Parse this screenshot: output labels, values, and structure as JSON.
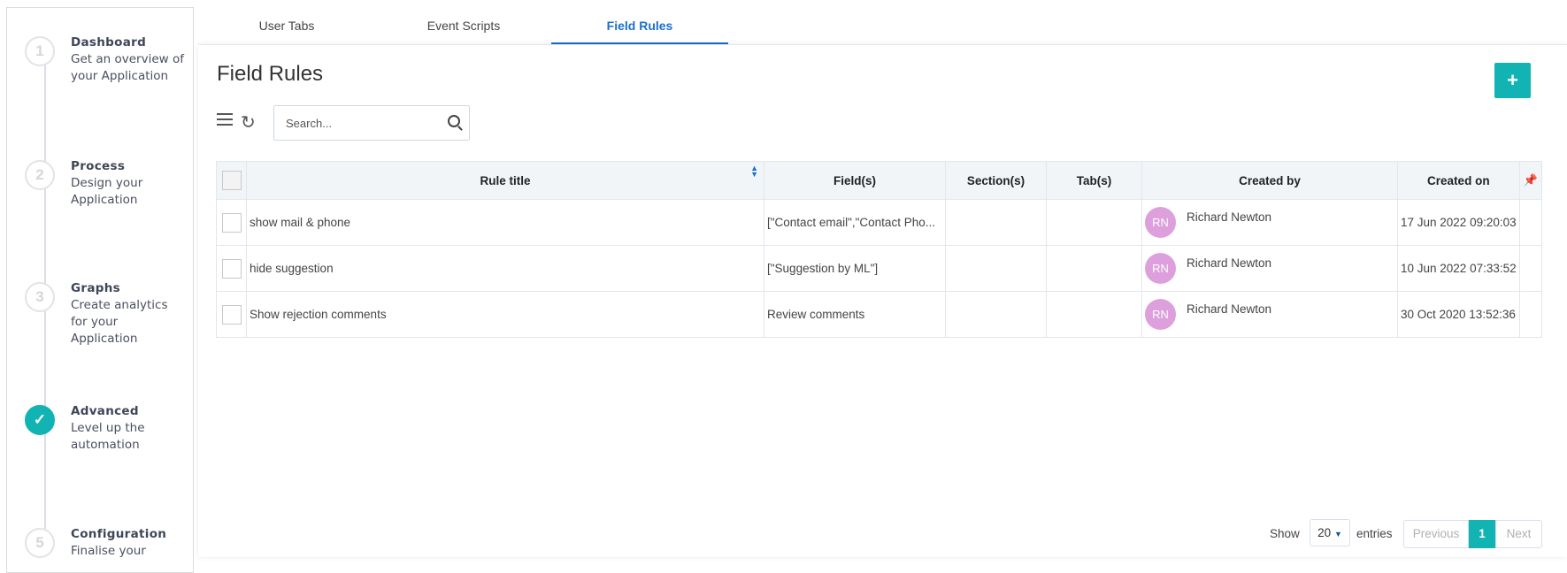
{
  "steps": [
    {
      "num": "1",
      "title": "Dashboard",
      "desc": "Get an overview of your Application",
      "done": false
    },
    {
      "num": "2",
      "title": "Process",
      "desc": "Design your Application",
      "done": false
    },
    {
      "num": "3",
      "title": "Graphs",
      "desc": "Create analytics for your Application",
      "done": false
    },
    {
      "num": "4",
      "title": "Advanced",
      "desc": "Level up the automation",
      "done": true
    },
    {
      "num": "5",
      "title": "Configuration",
      "desc": "Finalise your",
      "done": false
    }
  ],
  "tabs": [
    "User Tabs",
    "Event Scripts",
    "Field Rules"
  ],
  "active_tab": "Field Rules",
  "title": "Field Rules",
  "add_label": "+",
  "search": {
    "placeholder": "Search..."
  },
  "table": {
    "headers": [
      "Rule title",
      "Field(s)",
      "Section(s)",
      "Tab(s)",
      "Created by",
      "Created on"
    ],
    "rows": [
      {
        "title": "show mail & phone",
        "fields": "[\"Contact email\",\"Contact Pho...",
        "sections": "",
        "tabs": "",
        "initials": "RN",
        "creator": "Richard Newton",
        "created": "17 Jun 2022 09:20:03"
      },
      {
        "title": "hide suggestion",
        "fields": "[\"Suggestion by ML\"]",
        "sections": "",
        "tabs": "",
        "initials": "RN",
        "creator": "Richard Newton",
        "created": "10 Jun 2022 07:33:52"
      },
      {
        "title": "Show rejection comments",
        "fields": "Review comments",
        "sections": "",
        "tabs": "",
        "initials": "RN",
        "creator": "Richard Newton",
        "created": "30 Oct 2020 13:52:36"
      }
    ]
  },
  "pager": {
    "show": "Show",
    "page_size": "20",
    "entries": "entries",
    "previous": "Previous",
    "page": "1",
    "next": "Next"
  },
  "colors": {
    "accent": "#12b3b3",
    "tab_active": "#1a6fcf",
    "avatar": "#dda0dd"
  }
}
